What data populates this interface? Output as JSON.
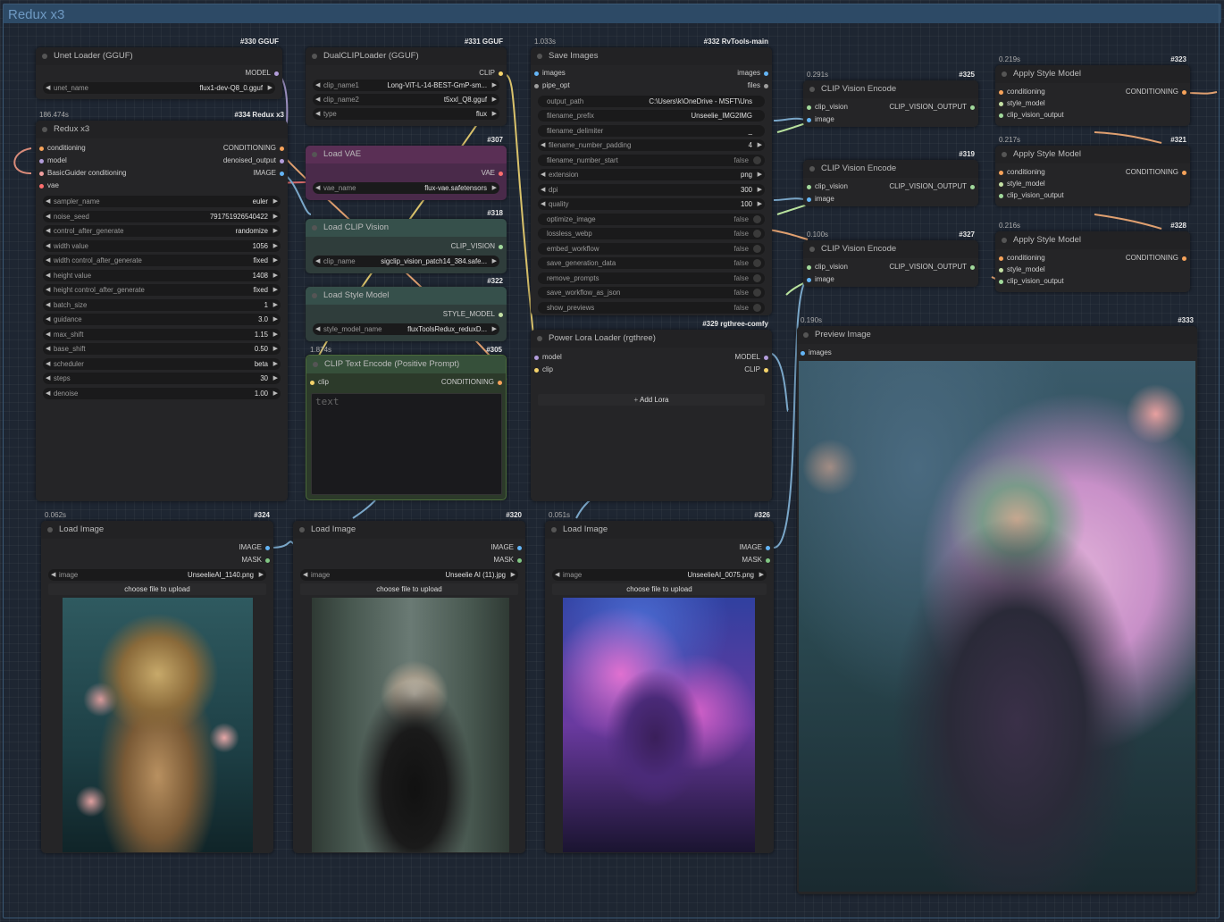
{
  "group": {
    "title": "Redux x3"
  },
  "unet": {
    "id": "#330 GGUF",
    "title": "Unet Loader (GGUF)",
    "out": "MODEL",
    "w_label": "unet_name",
    "w_value": "flux1-dev-Q8_0.gguf"
  },
  "dualclip": {
    "id": "#331 GGUF",
    "title": "DualCLIPLoader (GGUF)",
    "out": "CLIP",
    "widgets": [
      {
        "l": "clip_name1",
        "v": "Long-ViT-L-14-BEST-GmP-sm..."
      },
      {
        "l": "clip_name2",
        "v": "t5xxl_Q8.gguf"
      },
      {
        "l": "type",
        "v": "flux"
      }
    ]
  },
  "redux": {
    "time": "186.474s",
    "id": "#334 Redux x3",
    "title": "Redux x3",
    "inputs": [
      "conditioning",
      "model",
      "BasicGuider conditioning",
      "vae"
    ],
    "outputs": [
      "CONDITIONING",
      "denoised_output",
      "IMAGE"
    ],
    "widgets": [
      {
        "l": "sampler_name",
        "v": "euler"
      },
      {
        "l": "noise_seed",
        "v": "791751926540422"
      },
      {
        "l": "control_after_generate",
        "v": "randomize"
      },
      {
        "l": "width value",
        "v": "1056"
      },
      {
        "l": "width control_after_generate",
        "v": "fixed"
      },
      {
        "l": "height value",
        "v": "1408"
      },
      {
        "l": "height control_after_generate",
        "v": "fixed"
      },
      {
        "l": "batch_size",
        "v": "1"
      },
      {
        "l": "guidance",
        "v": "3.0"
      },
      {
        "l": "max_shift",
        "v": "1.15"
      },
      {
        "l": "base_shift",
        "v": "0.50"
      },
      {
        "l": "scheduler",
        "v": "beta"
      },
      {
        "l": "steps",
        "v": "30"
      },
      {
        "l": "denoise",
        "v": "1.00"
      }
    ]
  },
  "vae": {
    "id": "#307",
    "title": "Load VAE",
    "out": "VAE",
    "w_label": "vae_name",
    "w_value": "flux-vae.safetensors"
  },
  "clipvision": {
    "id": "#318",
    "title": "Load CLIP Vision",
    "out": "CLIP_VISION",
    "w_label": "clip_name",
    "w_value": "sigclip_vision_patch14_384.safe..."
  },
  "stylemodel": {
    "id": "#322",
    "title": "Load Style Model",
    "out": "STYLE_MODEL",
    "w_label": "style_model_name",
    "w_value": "fluxToolsRedux_reduxD..."
  },
  "cliptext": {
    "time": "1.874s",
    "id": "#305",
    "title": "CLIP Text Encode (Positive Prompt)",
    "in": "clip",
    "out": "CONDITIONING",
    "placeholder": "text"
  },
  "save": {
    "time": "1.033s",
    "id": "#332 RvTools-main",
    "title": "Save Images",
    "inputs": [
      "images",
      "pipe_opt"
    ],
    "outputs": [
      "images",
      "files"
    ],
    "widgets": [
      {
        "l": "output_path",
        "v": "C:\\Users\\k\\OneDrive - MSFT\\Uns",
        "t": "plain"
      },
      {
        "l": "filename_prefix",
        "v": "Unseelie_IMG2IMG",
        "t": "plain"
      },
      {
        "l": "filename_delimiter",
        "v": "_",
        "t": "plain"
      },
      {
        "l": "filename_number_padding",
        "v": "4",
        "t": "arrow"
      },
      {
        "l": "filename_number_start",
        "v": "false",
        "t": "tog"
      },
      {
        "l": "extension",
        "v": "png",
        "t": "arrow"
      },
      {
        "l": "dpi",
        "v": "300",
        "t": "arrow"
      },
      {
        "l": "quality",
        "v": "100",
        "t": "arrow"
      },
      {
        "l": "optimize_image",
        "v": "false",
        "t": "tog"
      },
      {
        "l": "lossless_webp",
        "v": "false",
        "t": "tog"
      },
      {
        "l": "embed_workflow",
        "v": "false",
        "t": "tog"
      },
      {
        "l": "save_generation_data",
        "v": "false",
        "t": "tog"
      },
      {
        "l": "remove_prompts",
        "v": "false",
        "t": "tog"
      },
      {
        "l": "save_workflow_as_json",
        "v": "false",
        "t": "tog"
      },
      {
        "l": "show_previews",
        "v": "false",
        "t": "tog"
      }
    ]
  },
  "lora": {
    "id": "#329 rgthree-comfy",
    "title": "Power Lora Loader (rgthree)",
    "inputs": [
      "model",
      "clip"
    ],
    "outputs": [
      "MODEL",
      "CLIP"
    ],
    "button": "Add Lora"
  },
  "cve1": {
    "time": "0.291s",
    "id": "#325",
    "title": "CLIP Vision Encode",
    "inputs": [
      "clip_vision",
      "image"
    ],
    "out": "CLIP_VISION_OUTPUT"
  },
  "cve2": {
    "time": "",
    "id": "#319",
    "title": "CLIP Vision Encode",
    "inputs": [
      "clip_vision",
      "image"
    ],
    "out": "CLIP_VISION_OUTPUT"
  },
  "cve3": {
    "time": "0.100s",
    "id": "#327",
    "title": "CLIP Vision Encode",
    "inputs": [
      "clip_vision",
      "image"
    ],
    "out": "CLIP_VISION_OUTPUT"
  },
  "asm1": {
    "time": "0.219s",
    "id": "#323",
    "title": "Apply Style Model",
    "inputs": [
      "conditioning",
      "style_model",
      "clip_vision_output"
    ],
    "out": "CONDITIONING"
  },
  "asm2": {
    "time": "0.217s",
    "id": "#321",
    "title": "Apply Style Model",
    "inputs": [
      "conditioning",
      "style_model",
      "clip_vision_output"
    ],
    "out": "CONDITIONING"
  },
  "asm3": {
    "time": "0.216s",
    "id": "#328",
    "title": "Apply Style Model",
    "inputs": [
      "conditioning",
      "style_model",
      "clip_vision_output"
    ],
    "out": "CONDITIONING"
  },
  "load1": {
    "time": "0.062s",
    "id": "#324",
    "title": "Load Image",
    "outputs": [
      "IMAGE",
      "MASK"
    ],
    "w_label": "image",
    "w_value": "UnseelieAI_1140.png",
    "button": "choose file to upload"
  },
  "load2": {
    "time": "",
    "id": "#320",
    "title": "Load Image",
    "outputs": [
      "IMAGE",
      "MASK"
    ],
    "w_label": "image",
    "w_value": "Unseelie AI (11).jpg",
    "button": "choose file to upload"
  },
  "load3": {
    "time": "0.051s",
    "id": "#326",
    "title": "Load Image",
    "outputs": [
      "IMAGE",
      "MASK"
    ],
    "w_label": "image",
    "w_value": "UnseelieAI_0075.png",
    "button": "choose file to upload"
  },
  "preview": {
    "time": "0.190s",
    "id": "#333",
    "title": "Preview Image",
    "in": "images"
  }
}
